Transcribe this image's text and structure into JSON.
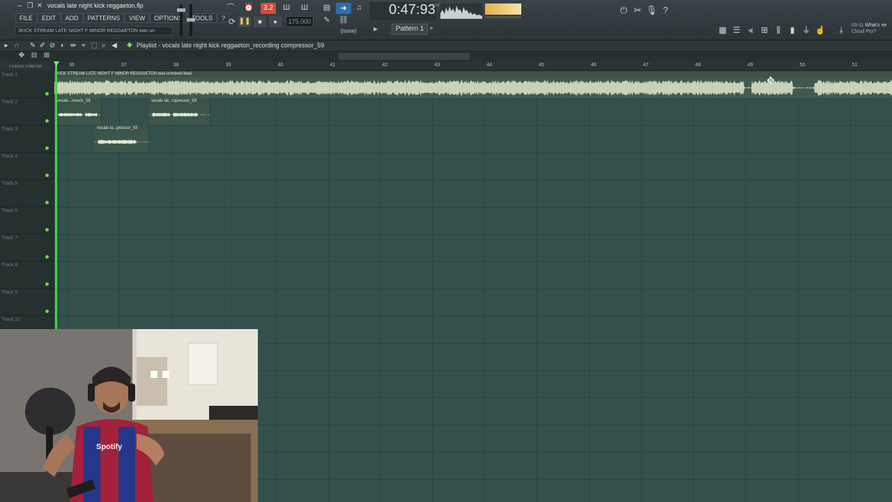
{
  "window": {
    "project_title": "vocals late night kick reggaeton.flp",
    "menu": [
      "FILE",
      "EDIT",
      "ADD",
      "PATTERNS",
      "VIEW",
      "OPTIONS",
      "TOOLS",
      "?"
    ],
    "hint": "3KICK STREAM LATE NIGHT F MINOR REGGAETON wav un"
  },
  "transport": {
    "rec_mode_label": "3.2",
    "tempo": "175.000",
    "snap": "(none)",
    "time": "0:47:93",
    "time_unit": "M:S:CS",
    "pattern": "Pattern 1"
  },
  "news": {
    "date": "03-11",
    "title": "What's ne",
    "subtitle": "Cloud Pro?"
  },
  "playlist": {
    "title": "Playlist - vocals late night kick reggaeton_recording compressor_59",
    "header_labels": "F.CROSS  STRETCH",
    "bars": [
      "36",
      "37",
      "38",
      "39",
      "40",
      "41",
      "42",
      "43",
      "44",
      "45",
      "46",
      "47",
      "48",
      "49",
      "50",
      "51"
    ],
    "tracks": [
      "Track 1",
      "Track 2",
      "Track 3",
      "Track 4",
      "Track 5",
      "Track 6",
      "Track 7",
      "Track 8",
      "Track 9",
      "Track 10"
    ],
    "clips": {
      "beat": "KICK STREAM LATE NIGHT F MINOR REGGAETON wav unmixed beat",
      "vocal_a": "vocals...ressor_58",
      "vocal_b": "vocals lat...mpressor_59",
      "vocal_c": "vocals la...pressor_53"
    }
  },
  "webcam": {
    "shirt_text": "Spotify"
  },
  "colors": {
    "accent_green": "#3fd63b",
    "grid_bg": "#34504d",
    "clip_bg": "#3f5b50",
    "record_red": "#d64a3a",
    "time_bg": "#2a3336"
  }
}
